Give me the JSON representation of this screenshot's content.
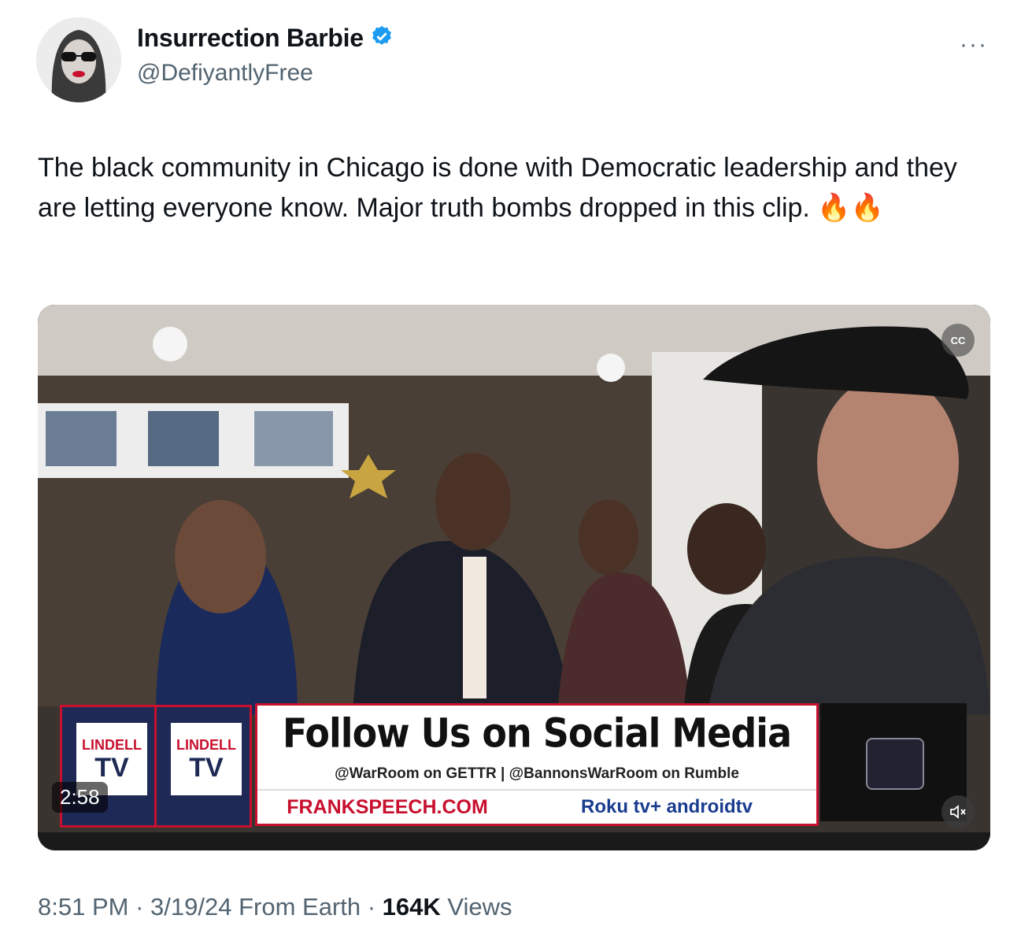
{
  "author": {
    "display_name": "Insurrection Barbie",
    "handle": "@DefiyantlyFree",
    "verified_icon": "verified-badge-icon"
  },
  "menu_icon": "more-horizontal-icon",
  "tweet": {
    "text": "The black community in Chicago is done with Democratic leadership and they are letting everyone know. Major truth bombs dropped in this clip. 🔥🔥"
  },
  "video": {
    "duration": "2:58",
    "overlay": {
      "title": "Follow Us on Social Media",
      "subtitle": "@WarRoom on GETTR  |  @BannonsWarRoom on Rumble",
      "site": "FRANKSPEECH.COM",
      "apps": "Roku  tv+  androidtv",
      "logo_left_top": "LINDELL",
      "logo_left_bottom": "TV"
    },
    "cc_icon": "closed-captions-icon",
    "mute_icon": "mute-icon"
  },
  "meta": {
    "time": "8:51 PM",
    "date": "3/19/24",
    "source": "From Earth",
    "views_count": "164K",
    "views_label": "Views"
  }
}
